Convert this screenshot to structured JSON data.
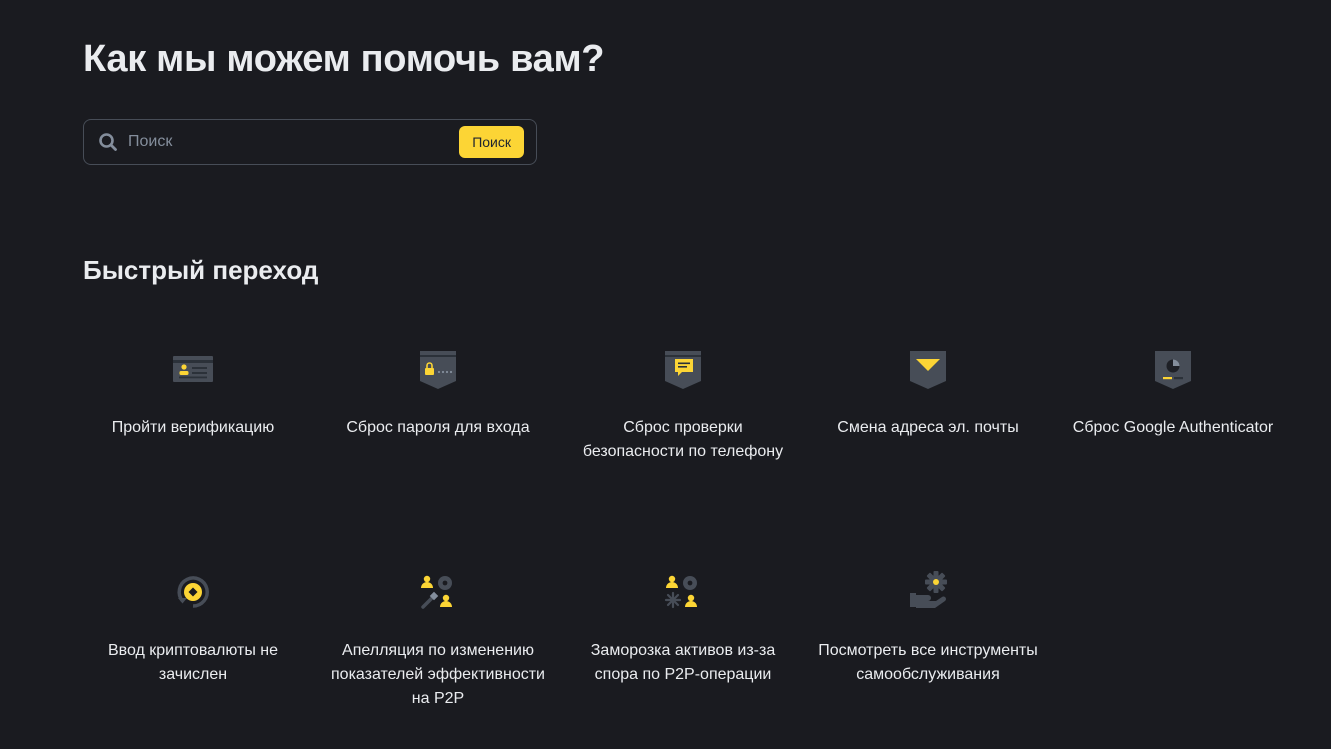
{
  "hero": {
    "title": "Как мы можем помочь вам?"
  },
  "search": {
    "placeholder": "Поиск",
    "value": "",
    "button_label": "Поиск"
  },
  "quick": {
    "title": "Быстрый переход",
    "items": [
      {
        "label": "Пройти верификацию",
        "icon": "id-card-icon"
      },
      {
        "label": "Сброс пароля для входа",
        "icon": "password-lock-icon"
      },
      {
        "label": "Сброс проверки безопасности по телефону",
        "icon": "phone-message-icon"
      },
      {
        "label": "Смена адреса эл. почты",
        "icon": "email-envelope-icon"
      },
      {
        "label": "Сброс Google Authenticator",
        "icon": "authenticator-icon"
      },
      {
        "label": "Ввод криптовалюты не зачислен",
        "icon": "crypto-deposit-icon"
      },
      {
        "label": "Апелляция по изменению показателей эффективности на P2P",
        "icon": "p2p-appeal-icon"
      },
      {
        "label": "Заморозка активов из-за спора по P2P-операции",
        "icon": "asset-freeze-icon"
      },
      {
        "label": "Посмотреть все инструменты самообслуживания",
        "icon": "self-service-icon"
      }
    ]
  },
  "colors": {
    "background": "#1a1b20",
    "accent": "#fcd535",
    "icon_gray": "#474d57",
    "text": "#eaecef",
    "placeholder": "#848e9c"
  }
}
